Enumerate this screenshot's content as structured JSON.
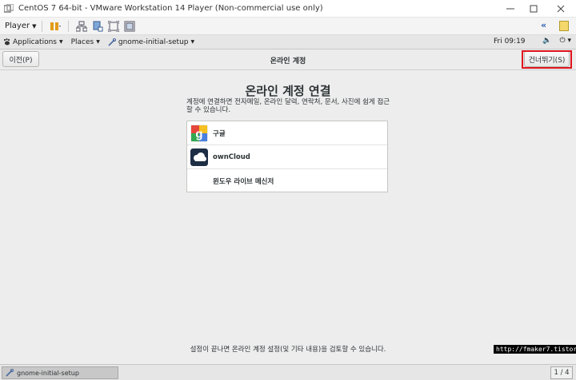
{
  "vmware": {
    "title": "CentOS 7 64-bit - VMware Workstation 14 Player (Non-commercial use only)",
    "player_label": "Player"
  },
  "gnome_bar": {
    "applications": "Applications",
    "places": "Places",
    "app_name": "gnome-initial-setup",
    "clock": "Fri 09:19"
  },
  "header": {
    "back_label": "이전(P)",
    "title": "온라인 계정",
    "skip_label": "건너뛰기(S)"
  },
  "main": {
    "title": "온라인 계정 연결",
    "description": "계정에 연결하면 전자메일, 온라인 달력, 연락처, 문서, 사진에 쉽게 접근할 수 있습니다.",
    "accounts": [
      {
        "label": "구글",
        "icon": "google-icon"
      },
      {
        "label": "ownCloud",
        "icon": "owncloud-icon"
      },
      {
        "label": "윈도우 라이브 메신저",
        "icon": ""
      }
    ],
    "footer": "설정이 끝나면 온라인 계정 설정(및 기타 내용)을 검토할 수 있습니다."
  },
  "watermark": "http://fmaker7.tistory.com",
  "bottom_panel": {
    "task_label": "gnome-initial-setup",
    "pager": "1 / 4"
  },
  "colors": {
    "highlight": "#e0141e",
    "google_blue": "#4a7fe0",
    "owncloud_navy": "#1d2d44"
  }
}
